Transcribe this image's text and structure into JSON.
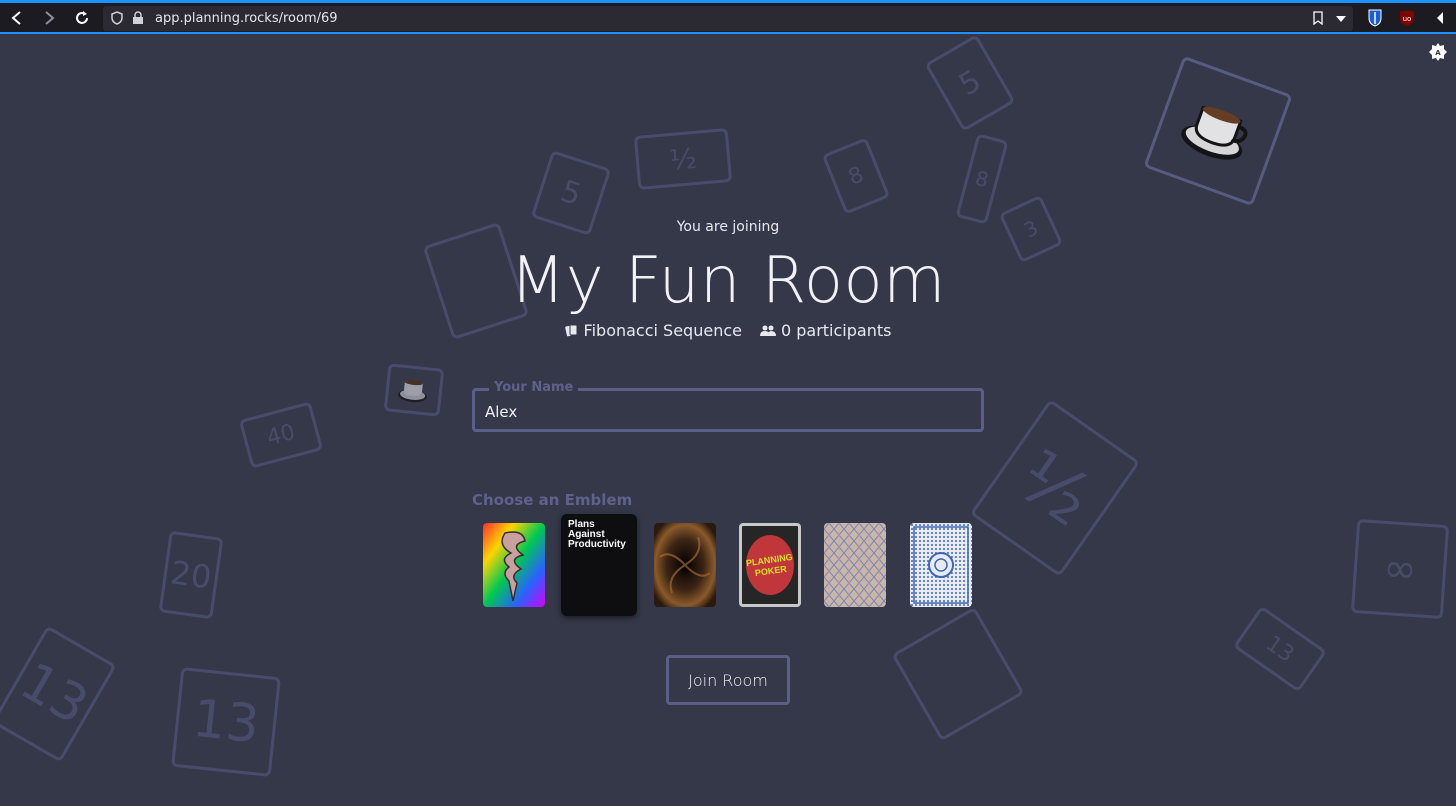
{
  "browser": {
    "url_domain": "app.planning.rocks",
    "url_path": "/room/69"
  },
  "room": {
    "joining_label": "You are joining",
    "name": "My Fun Room",
    "deck": "Fibonacci Sequence",
    "participants": "0 participants"
  },
  "form": {
    "name_label": "Your Name",
    "name_value": "Alex",
    "emblem_label": "Choose an Emblem"
  },
  "emblems": [
    {
      "name": "rainbow-swirl"
    },
    {
      "name": "plans-against-productivity",
      "text_line1": "Plans",
      "text_line2": "Against",
      "text_line3": "Productivity",
      "selected": true
    },
    {
      "name": "dark-vortex"
    },
    {
      "name": "planning-poker",
      "text": "PLANNING POKER"
    },
    {
      "name": "diamond-pattern"
    },
    {
      "name": "blue-mandala"
    }
  ],
  "actions": {
    "join_label": "Join Room"
  },
  "background_cards": [
    "5",
    "½",
    "5",
    "8",
    "8",
    "3",
    "40",
    "20",
    "13",
    "13",
    "∞",
    "½",
    "13"
  ]
}
